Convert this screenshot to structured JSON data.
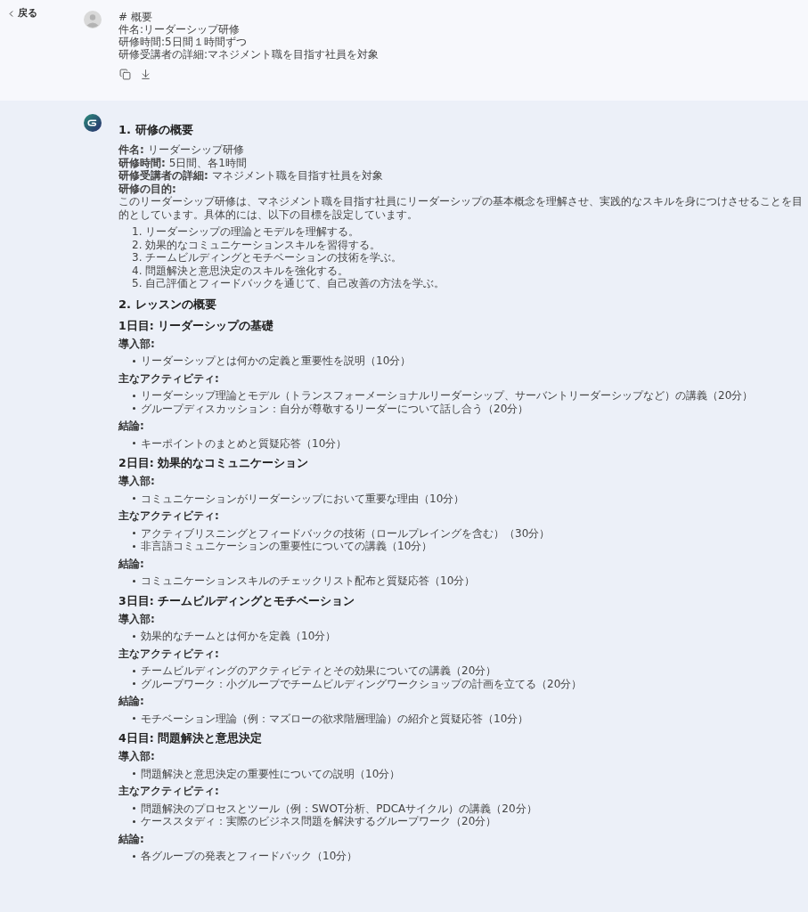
{
  "back": {
    "label": "戻る"
  },
  "user_message": {
    "lines": [
      "# 概要",
      "件名:リーダーシップ研修",
      "研修時間:5日間１時間ずつ",
      "研修受講者の詳細:マネジメント職を目指す社員を対象"
    ]
  },
  "response": {
    "blocks": [
      {
        "kind": "h2",
        "text": "1. 研修の概要"
      },
      {
        "kind": "info",
        "lines": [
          "**件名:** リーダーシップ研修",
          "**研修時間:** 5日間、各1時間",
          "**研修受講者の詳細:** マネジメント職を目指す社員を対象",
          "**研修の目的:**"
        ]
      },
      {
        "kind": "paragraph",
        "text": "このリーダーシップ研修は、マネジメント職を目指す社員にリーダーシップの基本概念を理解させ、実践的なスキルを身につけさせることを目的としています。具体的には、以下の目標を設定しています。"
      },
      {
        "kind": "ordered",
        "items": [
          "1. リーダーシップの理論とモデルを理解する。",
          "2. 効果的なコミュニケーションスキルを習得する。",
          "3. チームビルディングとモチベーションの技術を学ぶ。",
          "4. 問題解決と意思決定のスキルを強化する。",
          "5. 自己評価とフィードバックを通じて、自己改善の方法を学ぶ。"
        ]
      },
      {
        "kind": "h2",
        "text": "2. レッスンの概要"
      },
      {
        "kind": "h3",
        "text": "1日目: リーダーシップの基礎"
      },
      {
        "kind": "label",
        "text": "導入部:"
      },
      {
        "kind": "bullets",
        "items": [
          "リーダーシップとは何かの定義と重要性を説明（10分）"
        ]
      },
      {
        "kind": "label",
        "text": "主なアクティビティ:"
      },
      {
        "kind": "bullets",
        "items": [
          "リーダーシップ理論とモデル（トランスフォーメーショナルリーダーシップ、サーバントリーダーシップなど）の講義（20分）",
          "グループディスカッション：自分が尊敬するリーダーについて話し合う（20分）"
        ]
      },
      {
        "kind": "label",
        "text": "結論:"
      },
      {
        "kind": "bullets",
        "items": [
          "キーポイントのまとめと質疑応答（10分）"
        ]
      },
      {
        "kind": "h3",
        "text": "2日目: 効果的なコミュニケーション"
      },
      {
        "kind": "label",
        "text": "導入部:"
      },
      {
        "kind": "bullets",
        "items": [
          "コミュニケーションがリーダーシップにおいて重要な理由（10分）"
        ]
      },
      {
        "kind": "label",
        "text": "主なアクティビティ:"
      },
      {
        "kind": "bullets",
        "items": [
          "アクティブリスニングとフィードバックの技術（ロールプレイングを含む）（30分）",
          "非言語コミュニケーションの重要性についての講義（10分）"
        ]
      },
      {
        "kind": "label",
        "text": "結論:"
      },
      {
        "kind": "bullets",
        "items": [
          "コミュニケーションスキルのチェックリスト配布と質疑応答（10分）"
        ]
      },
      {
        "kind": "h3",
        "text": "3日目: チームビルディングとモチベーション"
      },
      {
        "kind": "label",
        "text": "導入部:"
      },
      {
        "kind": "bullets",
        "items": [
          "効果的なチームとは何かを定義（10分）"
        ]
      },
      {
        "kind": "label",
        "text": "主なアクティビティ:"
      },
      {
        "kind": "bullets",
        "items": [
          "チームビルディングのアクティビティとその効果についての講義（20分）",
          "グループワーク：小グループでチームビルディングワークショップの計画を立てる（20分）"
        ]
      },
      {
        "kind": "label",
        "text": "結論:"
      },
      {
        "kind": "bullets",
        "items": [
          "モチベーション理論（例：マズローの欲求階層理論）の紹介と質疑応答（10分）"
        ]
      },
      {
        "kind": "h3",
        "text": "4日目: 問題解決と意思決定"
      },
      {
        "kind": "label",
        "text": "導入部:"
      },
      {
        "kind": "bullets",
        "items": [
          "問題解決と意思決定の重要性についての説明（10分）"
        ]
      },
      {
        "kind": "label",
        "text": "主なアクティビティ:"
      },
      {
        "kind": "bullets",
        "items": [
          "問題解決のプロセスとツール（例：SWOT分析、PDCAサイクル）の講義（20分）",
          "ケーススタディ：実際のビジネス問題を解決するグループワーク（20分）"
        ]
      },
      {
        "kind": "label",
        "text": "結論:"
      },
      {
        "kind": "bullets",
        "items": [
          "各グループの発表とフィードバック（10分）"
        ]
      }
    ]
  }
}
